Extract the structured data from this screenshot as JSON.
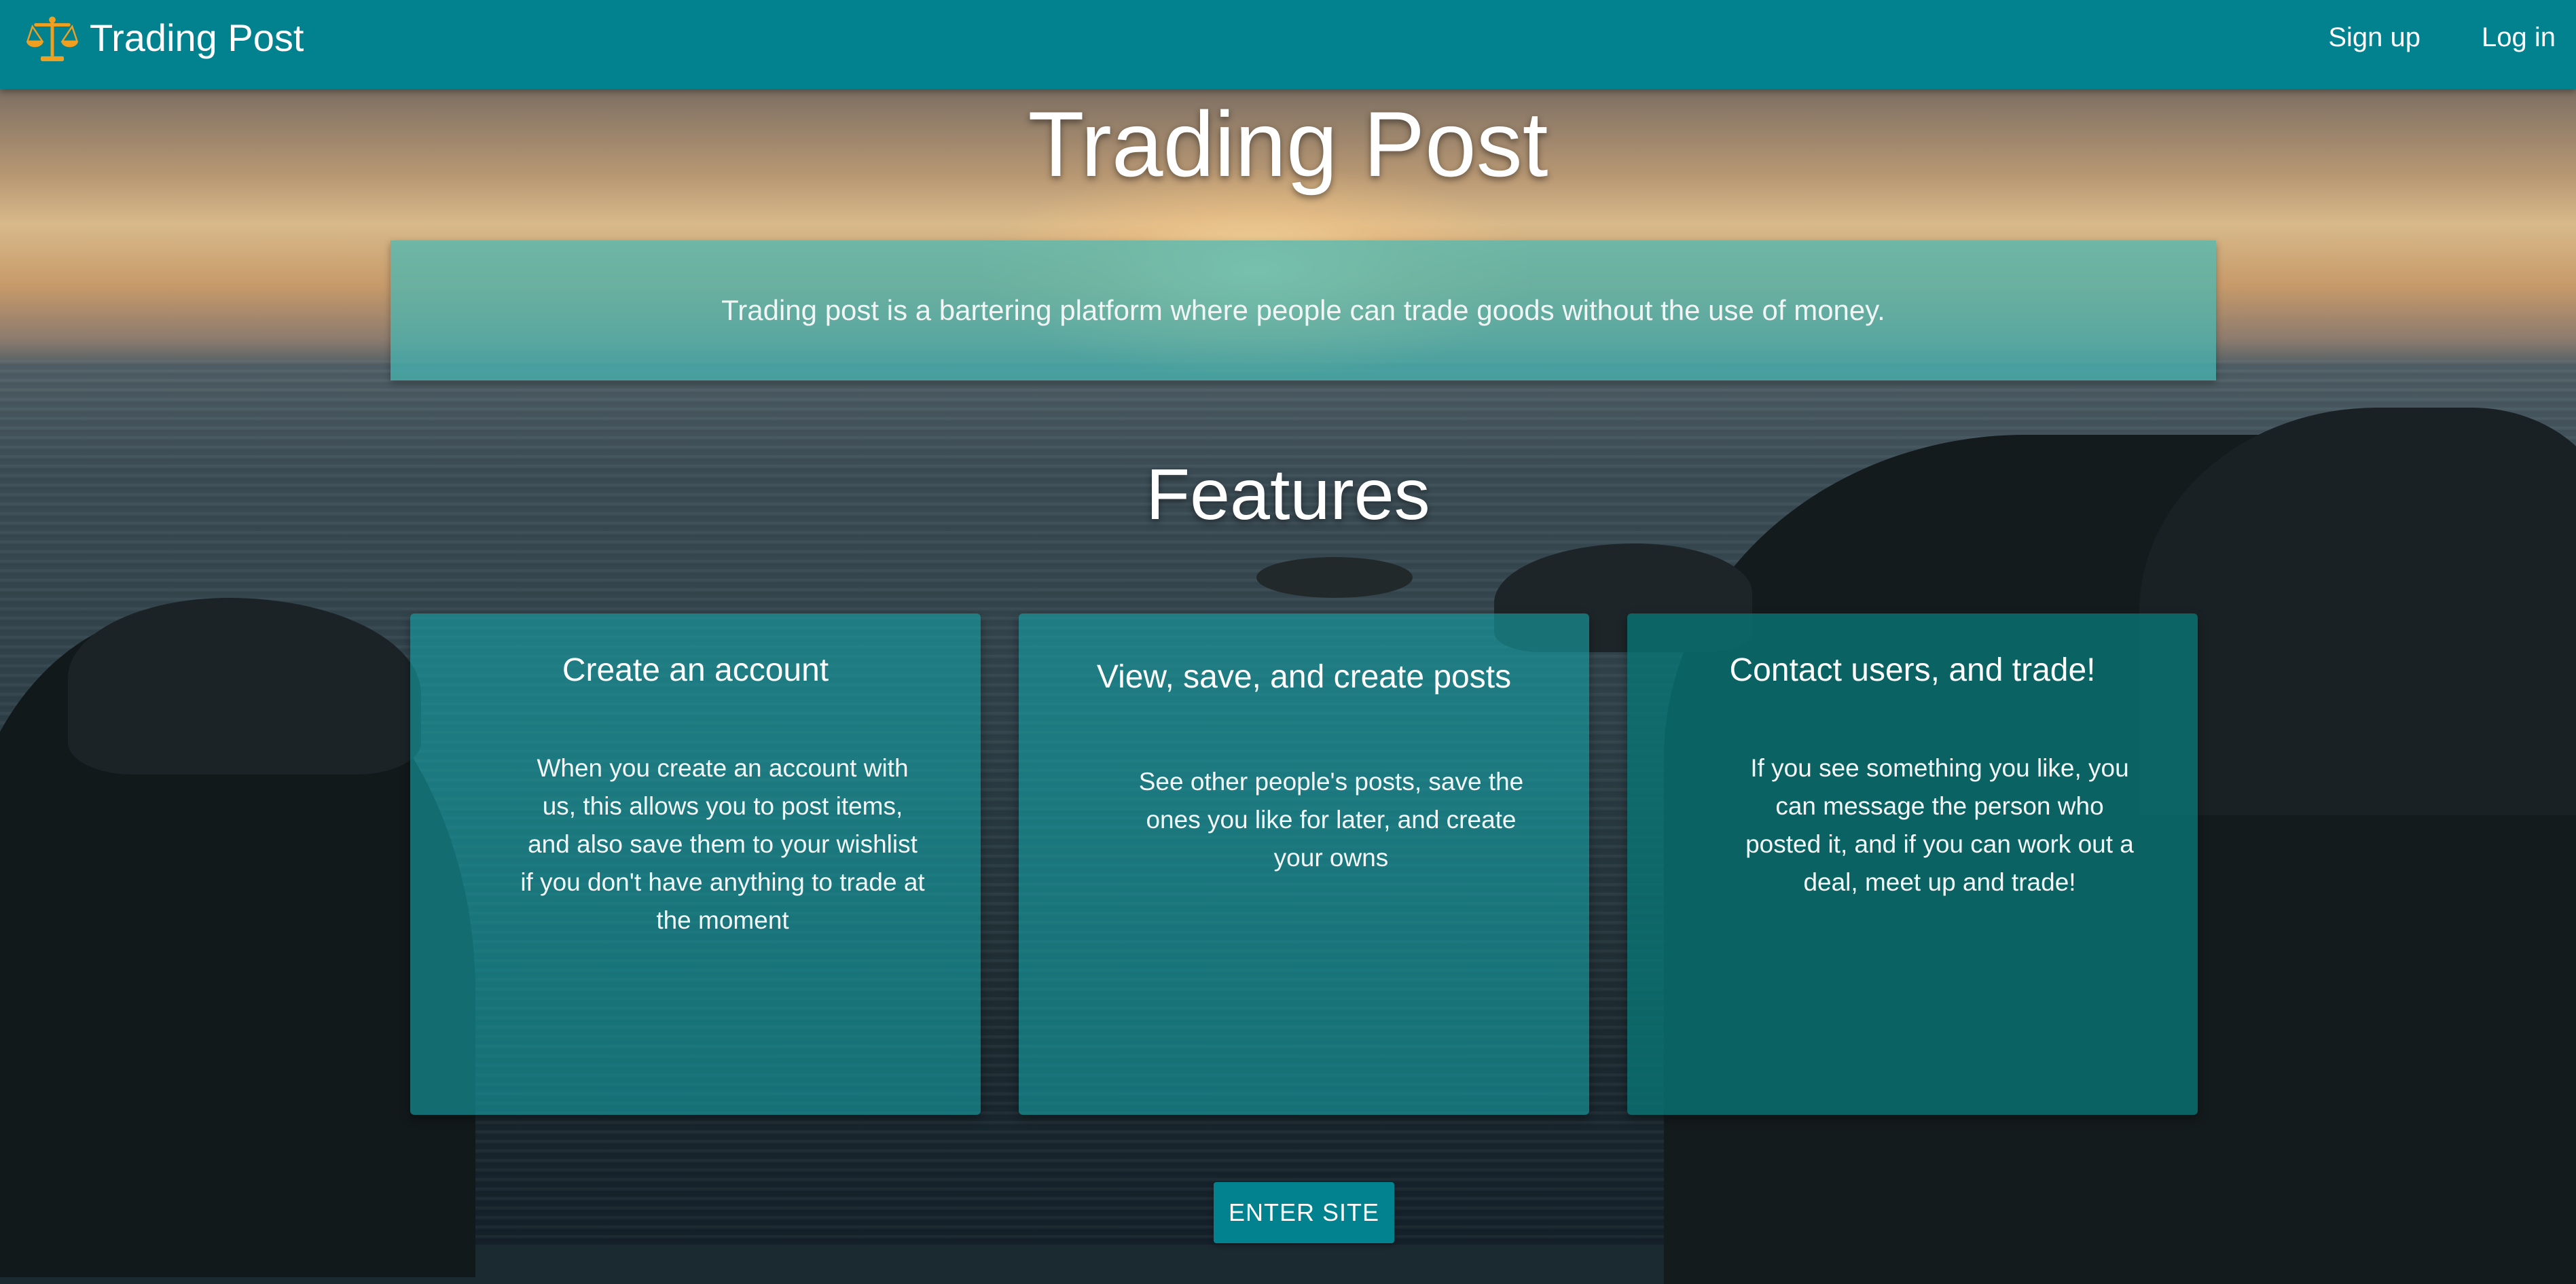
{
  "nav": {
    "brand": "Trading Post",
    "brand_icon": "scales-icon",
    "links": [
      "Sign up",
      "Log in"
    ]
  },
  "hero": {
    "title": "Trading Post",
    "tagline": "Trading post is a bartering platform where people can trade goods without the use of money."
  },
  "features": {
    "heading": "Features",
    "cards": [
      {
        "title": "Create an account",
        "body": "When you create an account with us, this allows you to post items, and also save them to your wishlist if you don't have anything to trade at the moment"
      },
      {
        "title": "View, save, and create posts",
        "body": "See other people's posts, save the ones you like for later, and create your owns"
      },
      {
        "title": "Contact users, and trade!",
        "body": "If you see something you like, you can message the person who posted it, and if you can work out a deal, meet up and trade!"
      }
    ]
  },
  "cta": {
    "label": "ENTER SITE"
  },
  "colors": {
    "primary": "#02828f",
    "brand_icon": "#f0a020"
  }
}
